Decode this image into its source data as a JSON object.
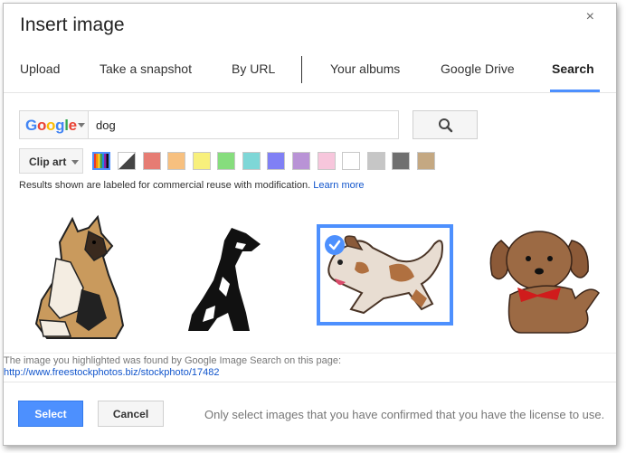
{
  "dialog": {
    "title": "Insert image",
    "close_glyph": "×"
  },
  "tabs": [
    {
      "label": "Upload",
      "active": false
    },
    {
      "label": "Take a snapshot",
      "active": false
    },
    {
      "label": "By URL",
      "active": false
    },
    {
      "label": "Your albums",
      "active": false
    },
    {
      "label": "Google Drive",
      "active": false
    },
    {
      "label": "Search",
      "active": true
    }
  ],
  "search": {
    "engine_label": "Google",
    "query": "dog",
    "button_icon": "magnifier-icon"
  },
  "filters": {
    "type_label": "Clip art",
    "swatches": [
      {
        "name": "any-color",
        "color": "multicolor"
      },
      {
        "name": "black-and-white",
        "color": "bw"
      },
      {
        "name": "red",
        "color": "#e67c73"
      },
      {
        "name": "orange",
        "color": "#f7c07f"
      },
      {
        "name": "yellow",
        "color": "#f8f07c"
      },
      {
        "name": "green",
        "color": "#86dd7d"
      },
      {
        "name": "teal",
        "color": "#7ed7d7"
      },
      {
        "name": "blue",
        "color": "#8080f5"
      },
      {
        "name": "purple",
        "color": "#b993d6"
      },
      {
        "name": "pink",
        "color": "#f7c6dc"
      },
      {
        "name": "white",
        "color": "#ffffff"
      },
      {
        "name": "gray",
        "color": "#c6c6c6"
      },
      {
        "name": "black",
        "color": "#6f6f6f"
      },
      {
        "name": "brown",
        "color": "#c4a882"
      }
    ]
  },
  "notice": {
    "text": "Results shown are labeled for commercial reuse with modification.",
    "link": "Learn more"
  },
  "results": [
    {
      "name": "collie-image",
      "selected": false
    },
    {
      "name": "pointer-silhouette-image",
      "selected": false
    },
    {
      "name": "spotted-dog-image",
      "selected": true
    },
    {
      "name": "brown-puppy-image",
      "selected": false
    }
  ],
  "source": {
    "text": "The image you highlighted was found by Google Image Search on this page:",
    "url": "http://www.freestockphotos.biz/stockphoto/17482"
  },
  "footer": {
    "select_label": "Select",
    "cancel_label": "Cancel",
    "license_note": "Only select images that you have confirmed that you have the license to use."
  },
  "colors": {
    "accent": "#4d90fe",
    "link": "#1155cc"
  }
}
